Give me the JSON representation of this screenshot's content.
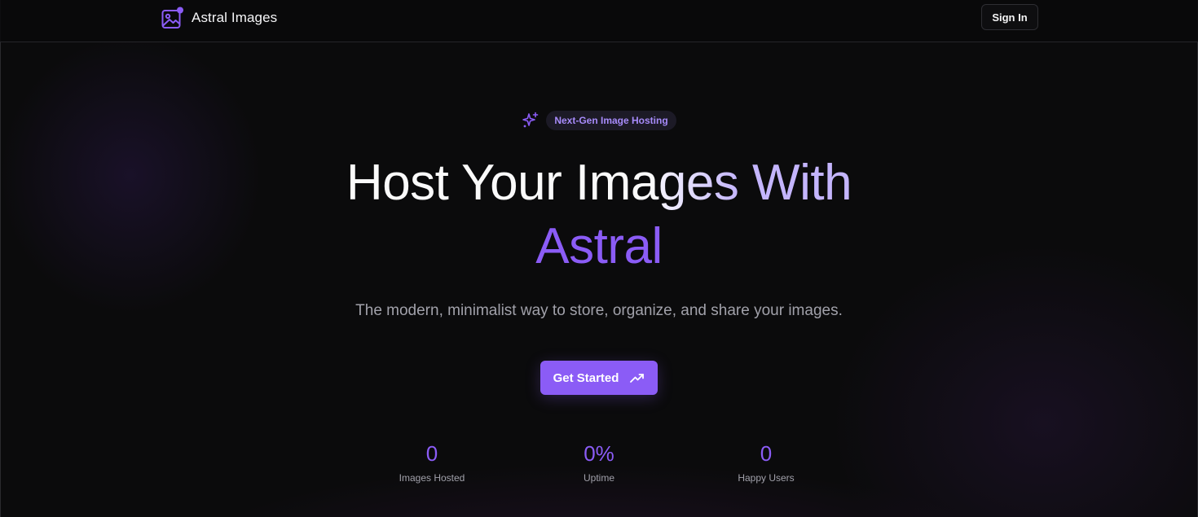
{
  "brand": {
    "name": "Astral Images",
    "icon": "image-icon",
    "accent_color": "#8b5cf6"
  },
  "header": {
    "signin_label": "Sign In"
  },
  "hero": {
    "badge_icon": "sparkles-icon",
    "badge_label": "Next-Gen Image Hosting",
    "title_part1": "Host Your Ima",
    "title_part2": "ges",
    "title_part3": " With",
    "title_line2": "Astral",
    "subtitle": "The modern, minimalist way to store, organize, and share your images.",
    "cta_label": "Get Started",
    "cta_icon": "trending-up-icon"
  },
  "stats": [
    {
      "value": "0",
      "label": "Images Hosted"
    },
    {
      "value": "0%",
      "label": "Uptime"
    },
    {
      "value": "0",
      "label": "Happy Users"
    }
  ],
  "colors": {
    "background": "#0b0b0c",
    "accent": "#8b5cf6",
    "accent_light": "#c4b5fd",
    "muted_text": "#a1a1aa"
  }
}
